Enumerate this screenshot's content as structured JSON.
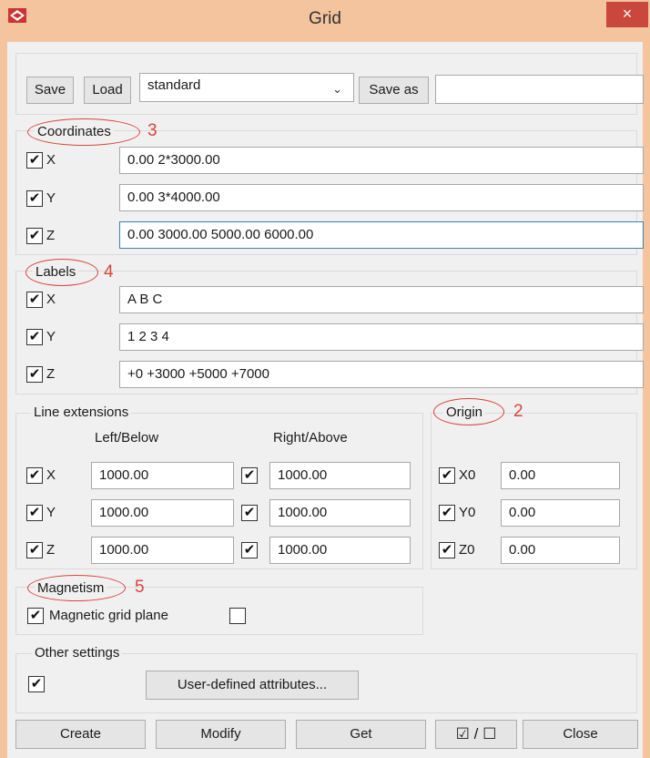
{
  "window": {
    "title": "Grid",
    "close_glyph": "×",
    "icon": "app-icon"
  },
  "toolbar": {
    "save_label": "Save",
    "load_label": "Load",
    "preset_value": "standard",
    "save_as_label": "Save as",
    "save_as_value": ""
  },
  "coordinates": {
    "title": "Coordinates",
    "callout_number": "3",
    "rows": [
      {
        "axis": "X",
        "checked": true,
        "value": "0.00 2*3000.00"
      },
      {
        "axis": "Y",
        "checked": true,
        "value": "0.00 3*4000.00"
      },
      {
        "axis": "Z",
        "checked": true,
        "value": "0.00 3000.00 5000.00 6000.00"
      }
    ]
  },
  "labels": {
    "title": "Labels",
    "callout_number": "4",
    "rows": [
      {
        "axis": "X",
        "checked": true,
        "value": "A B C"
      },
      {
        "axis": "Y",
        "checked": true,
        "value": "1 2 3 4"
      },
      {
        "axis": "Z",
        "checked": true,
        "value": "+0 +3000 +5000 +7000"
      }
    ]
  },
  "line_extensions": {
    "title": "Line extensions",
    "left_header": "Left/Below",
    "right_header": "Right/Above",
    "rows": [
      {
        "axis": "X",
        "checked": true,
        "left": "1000.00",
        "right_checked": true,
        "right": "1000.00"
      },
      {
        "axis": "Y",
        "checked": true,
        "left": "1000.00",
        "right_checked": true,
        "right": "1000.00"
      },
      {
        "axis": "Z",
        "checked": true,
        "left": "1000.00",
        "right_checked": true,
        "right": "1000.00"
      }
    ]
  },
  "origin": {
    "title": "Origin",
    "callout_number": "2",
    "rows": [
      {
        "axis": "X0",
        "checked": true,
        "value": "0.00"
      },
      {
        "axis": "Y0",
        "checked": true,
        "value": "0.00"
      },
      {
        "axis": "Z0",
        "checked": true,
        "value": "0.00"
      }
    ]
  },
  "magnetism": {
    "title": "Magnetism",
    "callout_number": "5",
    "plane_checked": true,
    "plane_label": "Magnetic grid plane",
    "extra_checked": false
  },
  "other_settings": {
    "title": "Other settings",
    "checked": true,
    "attributes_label": "User-defined attributes..."
  },
  "footer": {
    "create_label": "Create",
    "modify_label": "Modify",
    "get_label": "Get",
    "toggle_label": "☑ / ☐",
    "close_label": "Close"
  },
  "check_glyph": "✔"
}
